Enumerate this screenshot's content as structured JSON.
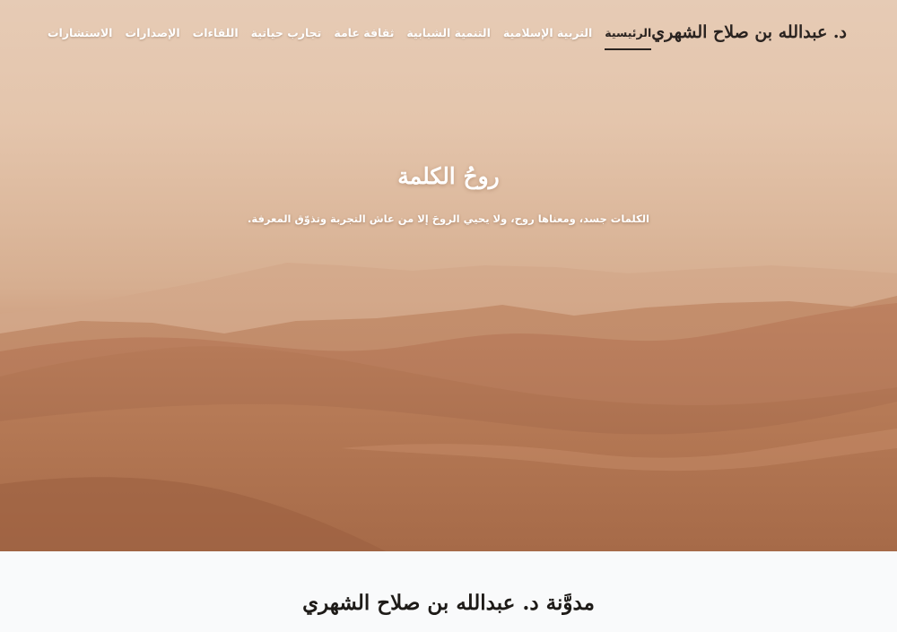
{
  "header": {
    "brand": "د. عبدالله بن صلاح الشهري"
  },
  "nav": {
    "items": [
      "الرئيسية",
      "التربية الإسلامية",
      "التنمية الشبابية",
      "ثقافة عامة",
      "تجارب حياتية",
      "اللقاءات",
      "الإصدارات",
      "الاستشارات"
    ],
    "active_index": 0
  },
  "hero": {
    "title": "روحُ الكلمة",
    "subtitle": "الكلمات جسد، ومعناها روح، ولا يحيي الروحَ إلا من عاش التجربة وتذوّق المعرفة."
  },
  "section": {
    "title": "مدوَّنة د. عبدالله بن صلاح الشهري"
  },
  "colors": {
    "sky": "#e4c5ac",
    "dunes": "#b87a55",
    "page_bg": "#f9fafb",
    "dark_text": "#2a2320"
  }
}
